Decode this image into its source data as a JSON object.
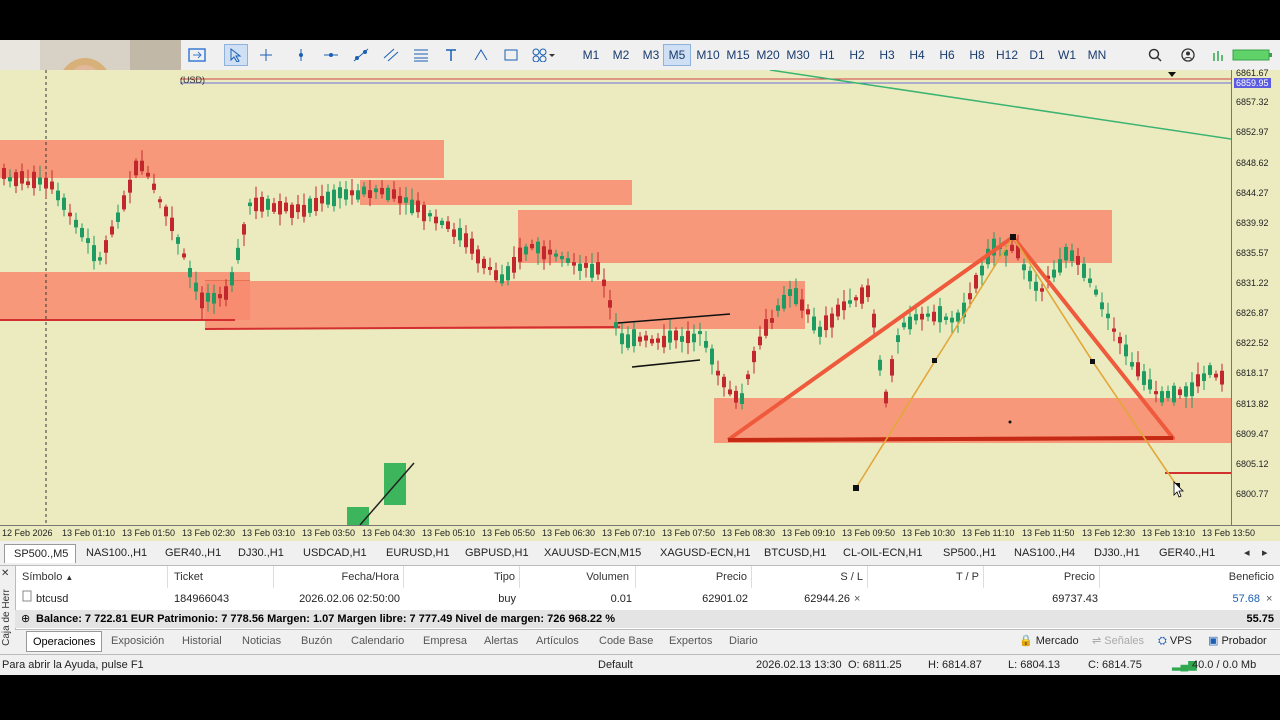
{
  "toolbar": {
    "timeframes": [
      "M1",
      "M2",
      "M3",
      "M5",
      "M10",
      "M15",
      "M20",
      "M30",
      "H1",
      "H2",
      "H3",
      "H4",
      "H6",
      "H8",
      "H12",
      "D1",
      "W1",
      "MN"
    ],
    "active_timeframe": "M5"
  },
  "chart": {
    "currency_label": "(USD)",
    "current_price_tag": "6859.95",
    "price_labels": [
      "6861.67",
      "6857.32",
      "6852.97",
      "6848.62",
      "6844.27",
      "6839.92",
      "6835.57",
      "6831.22",
      "6826.87",
      "6822.52",
      "6818.17",
      "6813.82",
      "6809.47",
      "6805.12",
      "6800.77"
    ],
    "time_labels": [
      "12 Feb 2026",
      "13 Feb 01:10",
      "13 Feb 01:50",
      "13 Feb 02:30",
      "13 Feb 03:10",
      "13 Feb 03:50",
      "13 Feb 04:30",
      "13 Feb 05:10",
      "13 Feb 05:50",
      "13 Feb 06:30",
      "13 Feb 07:10",
      "13 Feb 07:50",
      "13 Feb 08:30",
      "13 Feb 09:10",
      "13 Feb 09:50",
      "13 Feb 10:30",
      "13 Feb 11:10",
      "13 Feb 11:50",
      "13 Feb 12:30",
      "13 Feb 13:10",
      "13 Feb 13:50"
    ],
    "colors": {
      "bull": "#1e9b62",
      "bear": "#c1272d",
      "zone": "#f98f73",
      "background": "#ecebc0"
    }
  },
  "symbol_tabs": [
    "SP500.,M5",
    "NAS100.,H1",
    "GER40.,H1",
    "DJ30.,H1",
    "USDCAD,H1",
    "EURUSD,H1",
    "GBPUSD,H1",
    "XAUUSD-ECN,M15",
    "XAGUSD-ECN,H1",
    "BTCUSD,H1",
    "CL-OIL-ECN,H1",
    "SP500.,H1",
    "NAS100.,H4",
    "DJ30.,H1",
    "GER40.,H1"
  ],
  "toolbox": {
    "side_label": "Caja de Herr",
    "headers": {
      "symbol": "Símbolo",
      "ticket": "Ticket",
      "datetime": "Fecha/Hora",
      "type": "Tipo",
      "volume": "Volumen",
      "price": "Precio",
      "sl": "S / L",
      "tp": "T / P",
      "price2": "Precio",
      "profit": "Beneficio"
    },
    "row": {
      "symbol": "btcusd",
      "ticket": "184966043",
      "datetime": "2026.02.06 02:50:00",
      "type": "buy",
      "volume": "0.01",
      "price": "62901.02",
      "sl": "62944.26",
      "sl_close": "×",
      "price2": "69737.43",
      "profit": "57.68",
      "close": "×"
    },
    "balance": "Balance: 7 722.81 EUR  Patrimonio: 7 778.56  Margen: 1.07  Margen libre: 7 777.49  Nivel de margen: 726 968.22 %",
    "balance_total": "55.75",
    "tabs": [
      "Operaciones",
      "Exposición",
      "Historial",
      "Noticias",
      "Buzón",
      "Calendario",
      "Empresa",
      "Alertas",
      "Artículos",
      "Code Base",
      "Expertos",
      "Diario"
    ],
    "right_items": [
      "Mercado",
      "Señales",
      "VPS",
      "Probador"
    ]
  },
  "status": {
    "help": "Para abrir la Ayuda, pulse F1",
    "profile": "Default",
    "datetime": "2026.02.13 13:30",
    "open": "O: 6811.25",
    "high": "H: 6814.87",
    "low": "L: 6804.13",
    "close": "C: 6814.75",
    "network": "40.0 / 0.0 Mb"
  }
}
